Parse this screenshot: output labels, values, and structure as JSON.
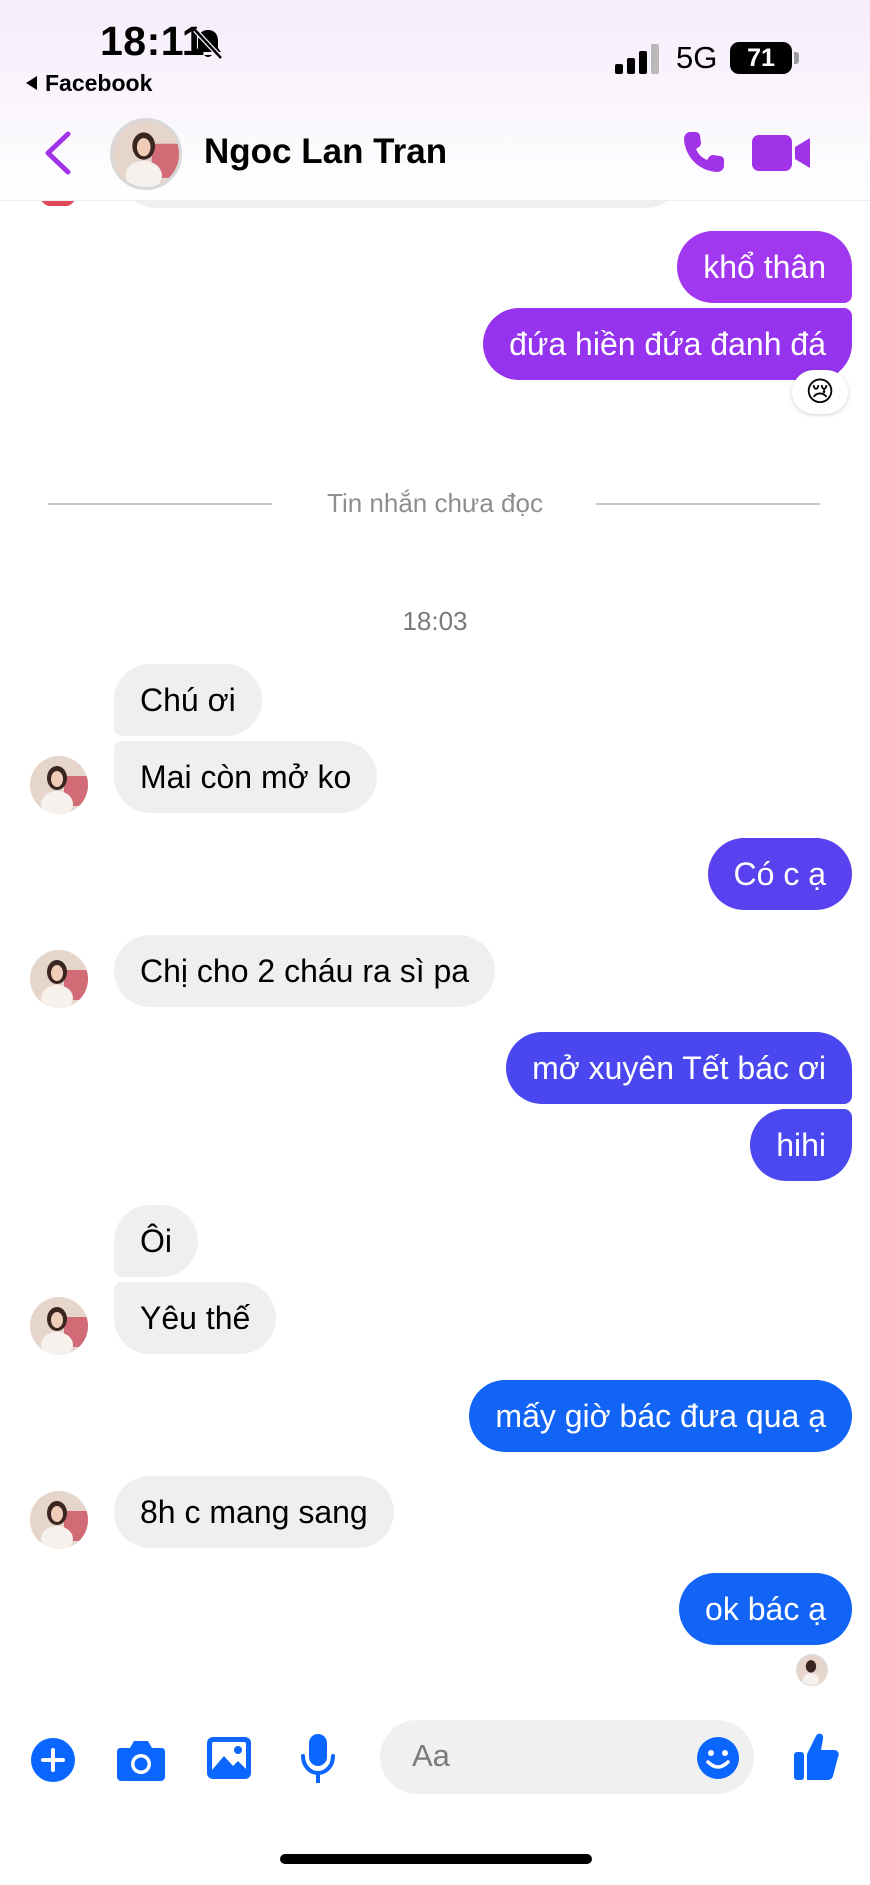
{
  "status_bar": {
    "time": "18:11",
    "back_app": "Facebook",
    "network": "5G",
    "battery": "71"
  },
  "header": {
    "contact_name": "Ngoc Lan Tran"
  },
  "chat": {
    "unread_divider": "Tin nhắn chưa đọc",
    "timestamp": "18:03",
    "reaction_emoji": "😢",
    "messages": [
      {
        "from": "me",
        "text": "khổ thân",
        "color": "#a237f0"
      },
      {
        "from": "me",
        "text": "đứa hiền đứa đanh đá",
        "color": "#9533ef"
      },
      {
        "from": "them",
        "text": "Chú ơi"
      },
      {
        "from": "them",
        "text": "Mai còn mở ko"
      },
      {
        "from": "me",
        "text": "Có c ạ",
        "color": "#5a41ef"
      },
      {
        "from": "them",
        "text": "Chị cho 2 cháu ra sì pa"
      },
      {
        "from": "me",
        "text": "mở xuyên Tết bác ơi",
        "color": "#4a47f1"
      },
      {
        "from": "me",
        "text": "hihi",
        "color": "#4b48f2"
      },
      {
        "from": "them",
        "text": "Ôi"
      },
      {
        "from": "them",
        "text": "Yêu thế"
      },
      {
        "from": "me",
        "text": "mấy giờ bác đưa qua ạ",
        "color": "#1264f7"
      },
      {
        "from": "them",
        "text": "8h c mang sang"
      },
      {
        "from": "me",
        "text": "ok bác ạ",
        "color": "#1264f7"
      }
    ]
  },
  "composer": {
    "placeholder": "Aa"
  },
  "colors": {
    "accent_purple": "#a033e8",
    "accent_blue": "#0a66ff"
  }
}
